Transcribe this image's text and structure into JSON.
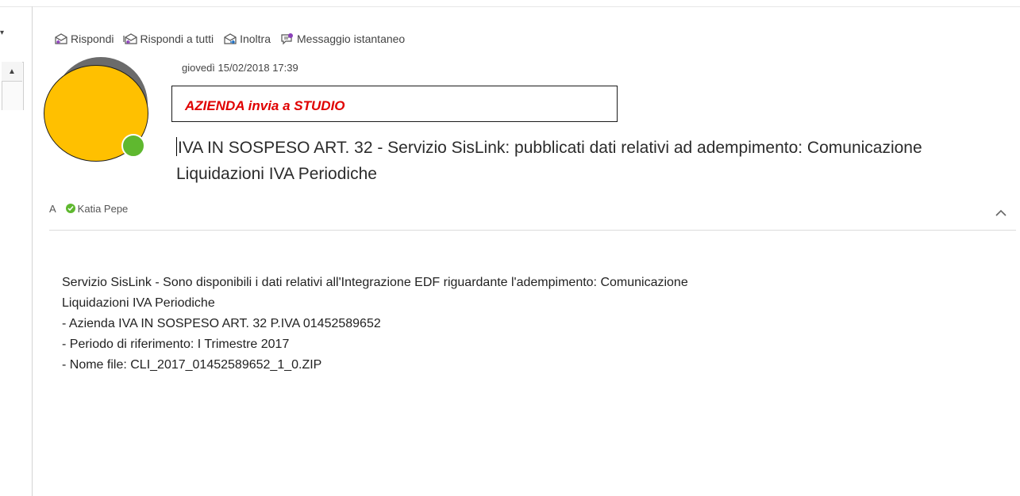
{
  "toolbar": {
    "reply": {
      "label": "Rispondi",
      "icon": "reply-icon"
    },
    "reply_all": {
      "label": "Rispondi a tutti",
      "icon": "reply-all-icon"
    },
    "forward": {
      "label": "Inoltra",
      "icon": "forward-icon"
    },
    "instant_message": {
      "label": "Messaggio istantaneo",
      "icon": "instant-message-icon"
    }
  },
  "message": {
    "date": "giovedì 15/02/2018 17:39",
    "annotation": "AZIENDA invia a STUDIO",
    "subject": "IVA IN SOSPESO ART. 32 - Servizio SisLink: pubblicati dati relativi ad adempimento: Comunicazione Liquidazioni IVA Periodiche",
    "to_label": "A",
    "recipient": "Katia Pepe",
    "body": [
      "Servizio SisLink - Sono disponibili i dati relativi all'Integrazione EDF riguardante l'adempimento: Comunicazione",
      "Liquidazioni IVA Periodiche",
      "- Azienda IVA IN SOSPESO ART. 32 P.IVA 01452589652",
      "- Periodo di riferimento: I Trimestre 2017",
      "- Nome file: CLI_2017_01452589652_1_0.ZIP"
    ]
  },
  "colors": {
    "avatar_fill": "#ffc000",
    "presence": "#5fb82f",
    "annotation_text": "#e00000"
  }
}
